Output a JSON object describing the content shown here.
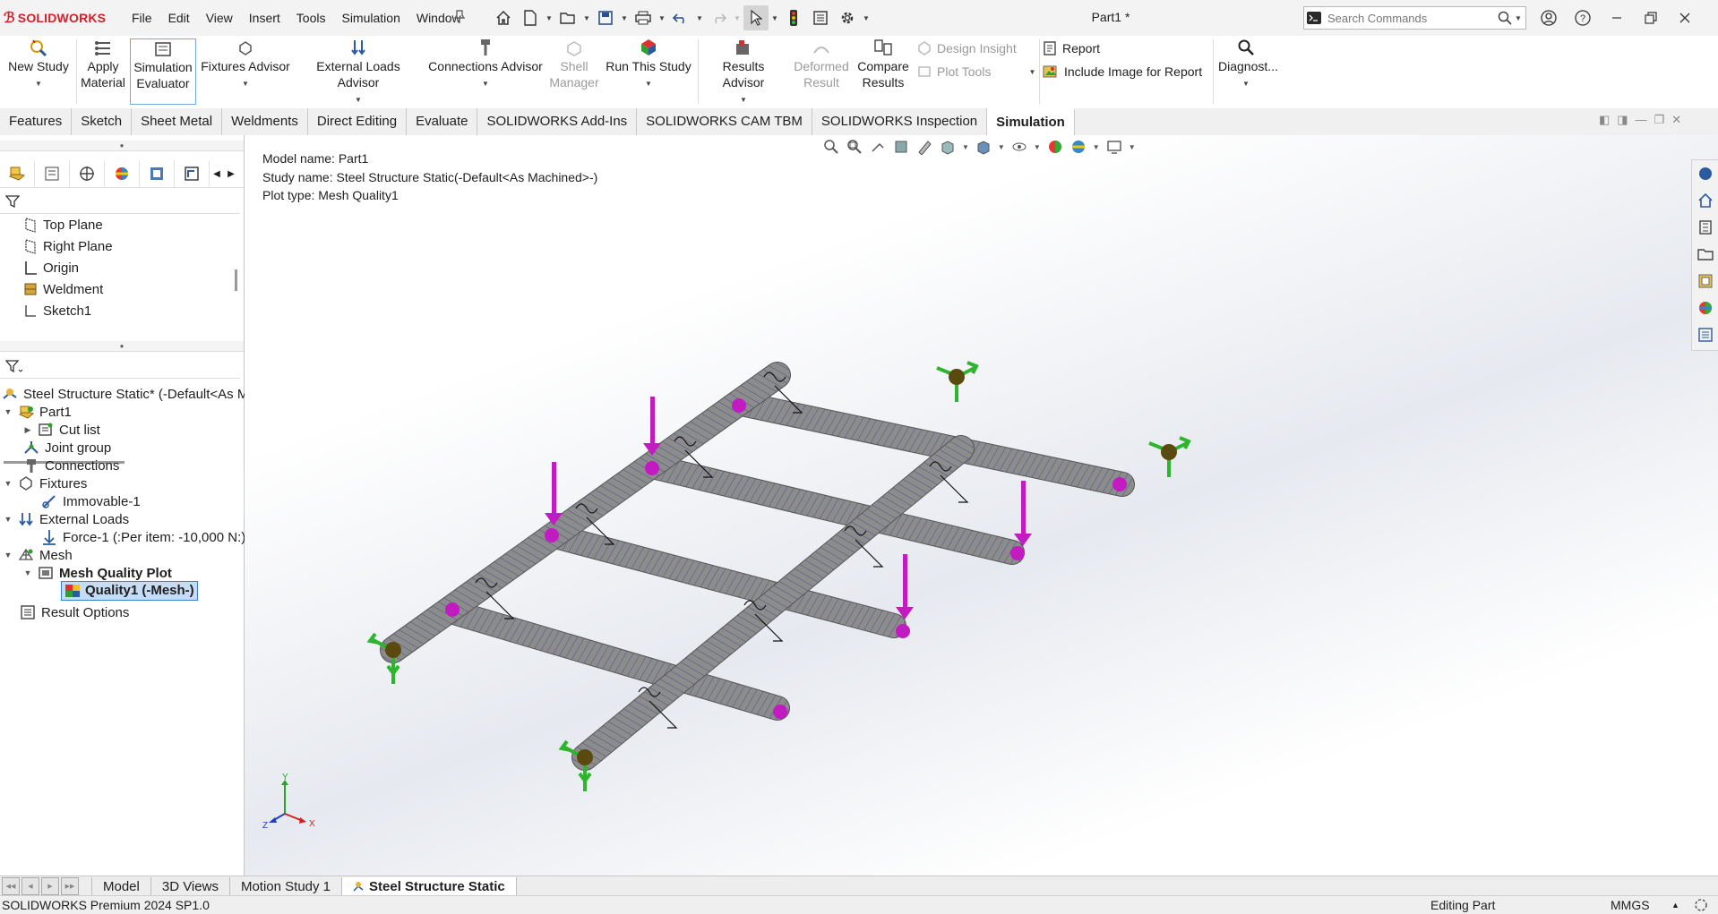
{
  "app": {
    "brand": "SOLIDWORKS",
    "doc_title": "Part1 *"
  },
  "menu": [
    "File",
    "Edit",
    "View",
    "Insert",
    "Tools",
    "Simulation",
    "Window"
  ],
  "search": {
    "placeholder": "Search Commands"
  },
  "ribbon": {
    "new_study": [
      "New Study"
    ],
    "apply_material": [
      "Apply",
      "Material"
    ],
    "sim_evaluator": [
      "Simulation",
      "Evaluator"
    ],
    "fixtures_advisor": [
      "Fixtures Advisor"
    ],
    "external_loads": [
      "External Loads Advisor"
    ],
    "connections": [
      "Connections Advisor"
    ],
    "shell_manager": [
      "Shell",
      "Manager"
    ],
    "run_study": [
      "Run This Study"
    ],
    "results_advisor": [
      "Results Advisor"
    ],
    "deformed_result": [
      "Deformed",
      "Result"
    ],
    "compare_results": [
      "Compare",
      "Results"
    ],
    "design_insight": "Design Insight",
    "plot_tools": "Plot Tools",
    "report": "Report",
    "include_image": "Include Image for Report",
    "diagnostics": "Diagnost..."
  },
  "tabs": [
    "Features",
    "Sketch",
    "Sheet Metal",
    "Weldments",
    "Direct Editing",
    "Evaluate",
    "SOLIDWORKS Add-Ins",
    "SOLIDWORKS CAM TBM",
    "SOLIDWORKS Inspection",
    "Simulation"
  ],
  "active_tab": "Simulation",
  "feature_tree": [
    "Top Plane",
    "Right Plane",
    "Origin",
    "Weldment",
    "Sketch1"
  ],
  "sim_tree": {
    "study": "Steel Structure Static* (-Default<As M",
    "part": "Part1",
    "cut_list": "Cut list",
    "joint_group": "Joint group",
    "connections": "Connections",
    "fixtures": "Fixtures",
    "immovable": "Immovable-1",
    "external_loads": "External Loads",
    "force": "Force-1 (:Per item: -10,000 N:)",
    "mesh": "Mesh",
    "mesh_quality_plot": "Mesh Quality Plot",
    "quality1": "Quality1 (-Mesh-)",
    "result_options": "Result Options"
  },
  "viewport": {
    "model_name": "Model name: Part1",
    "study_name": "Study name: Steel Structure Static(-Default<As Machined>-)",
    "plot_type": "Plot type: Mesh Quality1",
    "triad": {
      "y": "Y",
      "x": "X",
      "z": "Z"
    }
  },
  "bottom_tabs": [
    "Model",
    "3D Views",
    "Motion Study 1",
    "Steel Structure Static"
  ],
  "active_bottom_tab": "Steel Structure Static",
  "status": {
    "left": "SOLIDWORKS Premium 2024 SP1.0",
    "mode": "Editing Part",
    "units": "MMGS"
  },
  "colors": {
    "brand_red": "#d1202a",
    "fixture_green": "#2db52d",
    "load_magenta": "#c21bc2",
    "beam_gray": "#8a8a8a"
  }
}
